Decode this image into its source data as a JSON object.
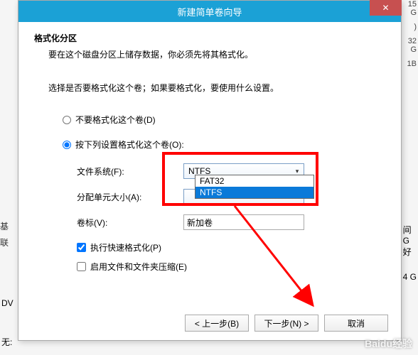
{
  "dialog": {
    "title": "新建简单卷向导",
    "close": "✕",
    "section_title": "格式化分区",
    "section_desc": "要在这个磁盘分区上储存数据，你必须先将其格式化。",
    "instruction": "选择是否要格式化这个卷；如果要格式化，要使用什么设置。",
    "radio_no": "不要格式化这个卷(D)",
    "radio_yes": "按下列设置格式化这个卷(O):",
    "fields": {
      "fs_label": "文件系统(F):",
      "fs_value": "NTFS",
      "alloc_label": "分配单元大小(A):",
      "alloc_value": "",
      "vol_label": "卷标(V):",
      "vol_value": "新加卷"
    },
    "dropdown": {
      "opt1": "FAT32",
      "opt2": "NTFS"
    },
    "chk_quick": "执行快速格式化(P)",
    "chk_compress": "启用文件和文件夹压缩(E)",
    "btn_back": "< 上一步(B)",
    "btn_next": "下一步(N) >",
    "btn_cancel": "取消"
  },
  "bg": {
    "r1": "15 G",
    "r2": ")",
    "r3": "32 G",
    "r4": "1B",
    "s1": "基",
    "s2": "联",
    "s3": "间",
    "s4": "G",
    "s5": "好",
    "s6": "4 G",
    "dv": "DV",
    "no": "无:"
  },
  "watermark": "Baidu经验"
}
